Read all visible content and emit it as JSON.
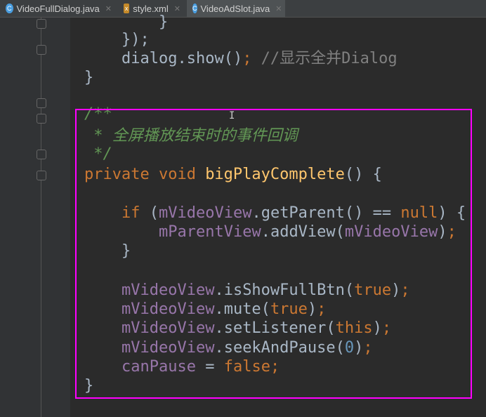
{
  "tabs": [
    {
      "label": "VideoFullDialog.java",
      "icon": "java-class-icon",
      "active": false
    },
    {
      "label": "style.xml",
      "icon": "xml-file-icon",
      "active": false
    },
    {
      "label": "VideoAdSlot.java",
      "icon": "java-class-icon",
      "active": true
    }
  ],
  "code_lines": [
    {
      "indent": 2,
      "tokens": [
        [
          "}",
          "pl"
        ]
      ]
    },
    {
      "indent": 1,
      "tokens": [
        [
          "});",
          "pl"
        ]
      ]
    },
    {
      "indent": 1,
      "tokens": [
        [
          "dialog.show()",
          "pl"
        ],
        [
          ";",
          "kw"
        ],
        [
          " //显示全并Dialog",
          "cm"
        ]
      ]
    },
    {
      "indent": 0,
      "tokens": [
        [
          "}",
          "pl"
        ]
      ]
    },
    {
      "indent": 0,
      "tokens": []
    },
    {
      "indent": 0,
      "tokens": [
        [
          "/**",
          "doc"
        ]
      ]
    },
    {
      "indent": 0,
      "tokens": [
        [
          " * 全屏播放结束时的事件回调",
          "doc"
        ]
      ]
    },
    {
      "indent": 0,
      "tokens": [
        [
          " */",
          "doc"
        ]
      ]
    },
    {
      "indent": 0,
      "tokens": [
        [
          "private void ",
          "kw"
        ],
        [
          "bigPlayComplete",
          "fn"
        ],
        [
          "() {",
          "pl"
        ]
      ]
    },
    {
      "indent": 0,
      "tokens": []
    },
    {
      "indent": 1,
      "tokens": [
        [
          "if ",
          "kw"
        ],
        [
          "(",
          "pl"
        ],
        [
          "mVideoView",
          "fd"
        ],
        [
          ".getParent() == ",
          "pl"
        ],
        [
          "null",
          "kw"
        ],
        [
          ") {",
          "pl"
        ]
      ]
    },
    {
      "indent": 2,
      "tokens": [
        [
          "mParentView",
          "fd"
        ],
        [
          ".addView(",
          "pl"
        ],
        [
          "mVideoView",
          "fd"
        ],
        [
          ")",
          "pl"
        ],
        [
          ";",
          "kw"
        ]
      ]
    },
    {
      "indent": 1,
      "tokens": [
        [
          "}",
          "pl"
        ]
      ]
    },
    {
      "indent": 0,
      "tokens": []
    },
    {
      "indent": 1,
      "tokens": [
        [
          "mVideoView",
          "fd"
        ],
        [
          ".isShowFullBtn(",
          "pl"
        ],
        [
          "true",
          "kw"
        ],
        [
          ")",
          "pl"
        ],
        [
          ";",
          "kw"
        ]
      ]
    },
    {
      "indent": 1,
      "tokens": [
        [
          "mVideoView",
          "fd"
        ],
        [
          ".mute(",
          "pl"
        ],
        [
          "true",
          "kw"
        ],
        [
          ")",
          "pl"
        ],
        [
          ";",
          "kw"
        ]
      ]
    },
    {
      "indent": 1,
      "tokens": [
        [
          "mVideoView",
          "fd"
        ],
        [
          ".setListener(",
          "pl"
        ],
        [
          "this",
          "kw"
        ],
        [
          ")",
          "pl"
        ],
        [
          ";",
          "kw"
        ]
      ]
    },
    {
      "indent": 1,
      "tokens": [
        [
          "mVideoView",
          "fd"
        ],
        [
          ".seekAndPause(",
          "pl"
        ],
        [
          "0",
          "num"
        ],
        [
          ")",
          "pl"
        ],
        [
          ";",
          "kw"
        ]
      ]
    },
    {
      "indent": 1,
      "tokens": [
        [
          "canPause",
          "fd"
        ],
        [
          " = ",
          "pl"
        ],
        [
          "false",
          "kw"
        ],
        [
          ";",
          "kw"
        ]
      ]
    },
    {
      "indent": 0,
      "tokens": [
        [
          "}",
          "pl"
        ]
      ]
    }
  ]
}
